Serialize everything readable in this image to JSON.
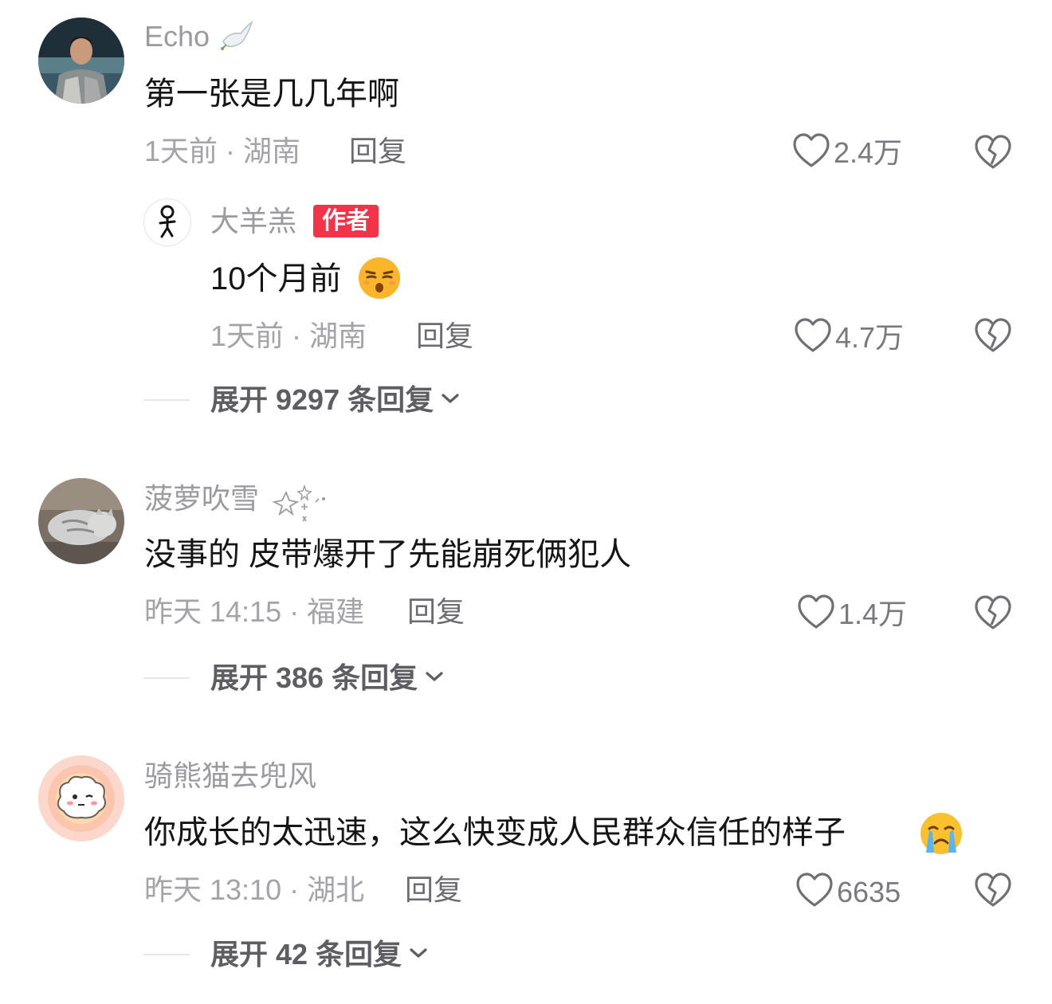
{
  "comments": [
    {
      "username": "Echo",
      "username_decoration": "dove-emoji",
      "content": "第一张是几几年啊",
      "meta": "1天前 · 湖南",
      "reply_label": "回复",
      "like_count": "2.4万",
      "reply": {
        "username": "大羊羔",
        "badge": "作者",
        "content": "10个月前",
        "content_emoji": "smug-face-emoji",
        "meta": "1天前 · 湖南",
        "reply_label": "回复",
        "like_count": "4.7万"
      },
      "expand_label": "展开 9297 条回复"
    },
    {
      "username": "菠萝吹雪",
      "username_decoration": "sparkle-stars",
      "content": "没事的 皮带爆开了先能崩死俩犯人",
      "meta": "昨天 14:15 · 福建",
      "reply_label": "回复",
      "like_count": "1.4万",
      "expand_label": "展开 386 条回复"
    },
    {
      "username": "骑熊猫去兜风",
      "content": "你成长的太迅速，这么快变成人民群众信任的样子",
      "content_emoji": "crying-face-emoji",
      "meta": "昨天 13:10 · 湖北",
      "reply_label": "回复",
      "like_count": "6635",
      "expand_label": "展开 42 条回复"
    }
  ],
  "colors": {
    "author_badge": "#f3334a",
    "username": "#9b9b9f",
    "content": "#151515",
    "meta": "#a4a4a8"
  }
}
